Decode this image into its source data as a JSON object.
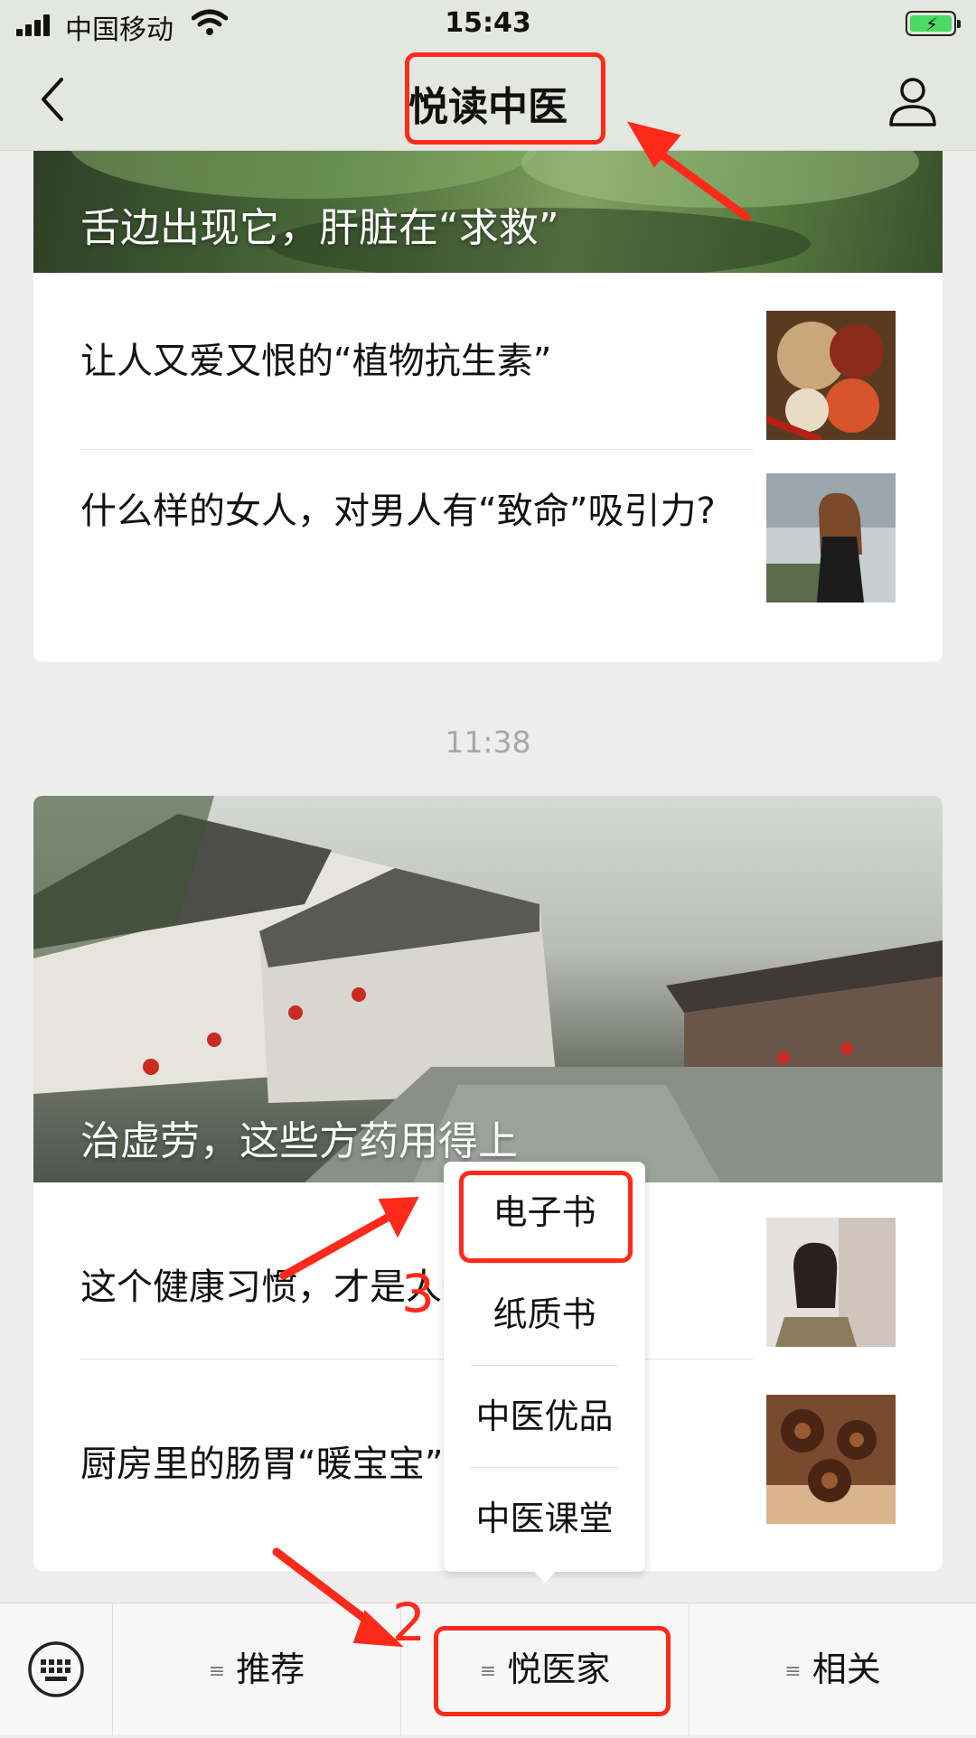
{
  "status_bar": {
    "carrier": "中国移动",
    "time": "15:43"
  },
  "nav": {
    "title": "悦读中医"
  },
  "card1": {
    "cover_title": "舌边出现它，肝脏在“求救”",
    "items": [
      {
        "title": "让人又爱又恨的“植物抗生素”"
      },
      {
        "title": "什么样的女人，对男人有“致命”吸引力?"
      }
    ]
  },
  "timestamp": "11:38",
  "card2": {
    "cover_title": "治虚劳，这些方药用得上",
    "items": [
      {
        "title": "这个健康习惯，才是人最好的保险"
      },
      {
        "title": "厨房里的肠胃“暖宝宝”"
      }
    ]
  },
  "popup_menu": {
    "items": [
      "电子书",
      "纸质书",
      "中医优品",
      "中医课堂"
    ]
  },
  "bottom_menu": {
    "tabs": [
      "推荐",
      "悦医家",
      "相关"
    ]
  },
  "annotations": {
    "step2": "2",
    "step3": "3"
  },
  "colors": {
    "annotation": "#ff2a1a",
    "nav_bg": "#e4e7e0",
    "page_bg": "#ededed"
  }
}
